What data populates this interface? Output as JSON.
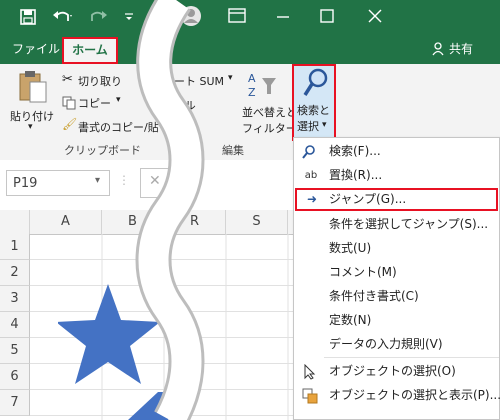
{
  "tabs": {
    "file": "ファイル",
    "home": "ホーム",
    "share": "共有"
  },
  "ribbon": {
    "paste": "貼り付け",
    "cut": "切り取り",
    "copy": "コピー",
    "format_painter": "書式のコピー/貼",
    "clipboard_group": "クリップボード",
    "autosum": "オート SUM",
    "fill": "フィル",
    "sort_filter_line1": "並べ替えと",
    "sort_filter_line2": "フィルター",
    "find_select_line1": "検索と",
    "find_select_line2": "選択",
    "editing_group": "編集"
  },
  "formula": {
    "name_box": "P19"
  },
  "columns": [
    "A",
    "B",
    "R",
    "S"
  ],
  "rows": [
    "1",
    "2",
    "3",
    "4",
    "5",
    "6",
    "7"
  ],
  "menu": {
    "items": [
      {
        "icon": "search-icon",
        "label": "検索(F)..."
      },
      {
        "icon": "replace-icon",
        "label": "置換(R)..."
      },
      {
        "icon": "arrow-right-icon",
        "label": "ジャンプ(G)..."
      },
      {
        "icon": "",
        "label": "条件を選択してジャンプ(S)..."
      },
      {
        "icon": "",
        "label": "数式(U)"
      },
      {
        "icon": "",
        "label": "コメント(M)"
      },
      {
        "icon": "",
        "label": "条件付き書式(C)"
      },
      {
        "icon": "",
        "label": "定数(N)"
      },
      {
        "icon": "",
        "label": "データの入力規則(V)"
      },
      {
        "icon": "pointer-icon",
        "label": "オブジェクトの選択(O)"
      },
      {
        "icon": "selection-pane-icon",
        "label": "オブジェクトの選択と表示(P)..."
      }
    ]
  },
  "colors": {
    "excel_green": "#217346",
    "highlight_red": "#e81123",
    "star_blue": "#4472c4"
  }
}
